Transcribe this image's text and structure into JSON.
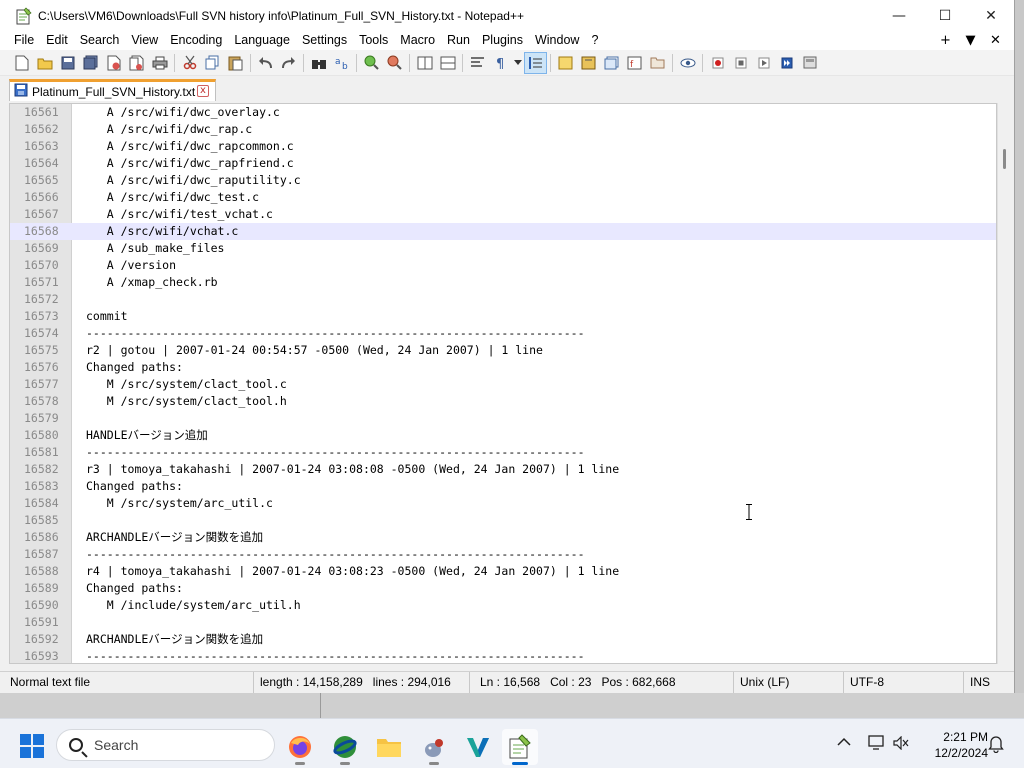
{
  "window": {
    "title": "C:\\Users\\VM6\\Downloads\\Full SVN history info\\Platinum_Full_SVN_History.txt - Notepad++",
    "minimize": "—",
    "maximize": "☐",
    "close": "✕"
  },
  "menu": {
    "items": [
      "File",
      "Edit",
      "Search",
      "View",
      "Encoding",
      "Language",
      "Settings",
      "Tools",
      "Macro",
      "Run",
      "Plugins",
      "Window",
      "?"
    ],
    "right": [
      "+",
      "▼",
      "✕"
    ]
  },
  "tab": {
    "label": "Platinum_Full_SVN_History.txt",
    "close": "x"
  },
  "editor": {
    "current_line": 16568,
    "lines": [
      {
        "n": "16561",
        "t": "   A /src/wifi/dwc_overlay.c"
      },
      {
        "n": "16562",
        "t": "   A /src/wifi/dwc_rap.c"
      },
      {
        "n": "16563",
        "t": "   A /src/wifi/dwc_rapcommon.c"
      },
      {
        "n": "16564",
        "t": "   A /src/wifi/dwc_rapfriend.c"
      },
      {
        "n": "16565",
        "t": "   A /src/wifi/dwc_raputility.c"
      },
      {
        "n": "16566",
        "t": "   A /src/wifi/dwc_test.c"
      },
      {
        "n": "16567",
        "t": "   A /src/wifi/test_vchat.c"
      },
      {
        "n": "16568",
        "t": "   A /src/wifi/vchat.c"
      },
      {
        "n": "16569",
        "t": "   A /sub_make_files"
      },
      {
        "n": "16570",
        "t": "   A /version"
      },
      {
        "n": "16571",
        "t": "   A /xmap_check.rb"
      },
      {
        "n": "16572",
        "t": ""
      },
      {
        "n": "16573",
        "t": "commit"
      },
      {
        "n": "16574",
        "t": "------------------------------------------------------------------------"
      },
      {
        "n": "16575",
        "t": "r2 | gotou | 2007-01-24 00:54:57 -0500 (Wed, 24 Jan 2007) | 1 line"
      },
      {
        "n": "16576",
        "t": "Changed paths:"
      },
      {
        "n": "16577",
        "t": "   M /src/system/clact_tool.c"
      },
      {
        "n": "16578",
        "t": "   M /src/system/clact_tool.h"
      },
      {
        "n": "16579",
        "t": ""
      },
      {
        "n": "16580",
        "t": "HANDLEバージョン追加"
      },
      {
        "n": "16581",
        "t": "------------------------------------------------------------------------"
      },
      {
        "n": "16582",
        "t": "r3 | tomoya_takahashi | 2007-01-24 03:08:08 -0500 (Wed, 24 Jan 2007) | 1 line"
      },
      {
        "n": "16583",
        "t": "Changed paths:"
      },
      {
        "n": "16584",
        "t": "   M /src/system/arc_util.c"
      },
      {
        "n": "16585",
        "t": ""
      },
      {
        "n": "16586",
        "t": "ARCHANDLEバージョン関数を追加"
      },
      {
        "n": "16587",
        "t": "------------------------------------------------------------------------"
      },
      {
        "n": "16588",
        "t": "r4 | tomoya_takahashi | 2007-01-24 03:08:23 -0500 (Wed, 24 Jan 2007) | 1 line"
      },
      {
        "n": "16589",
        "t": "Changed paths:"
      },
      {
        "n": "16590",
        "t": "   M /include/system/arc_util.h"
      },
      {
        "n": "16591",
        "t": ""
      },
      {
        "n": "16592",
        "t": "ARCHANDLEバージョン関数を追加"
      },
      {
        "n": "16593",
        "t": "------------------------------------------------------------------------"
      }
    ]
  },
  "status": {
    "file_type": "Normal text file",
    "length": "length : 14,158,289",
    "lines": "lines : 294,016",
    "ln": "Ln : 16,568",
    "col": "Col : 23",
    "pos": "Pos : 682,668",
    "eol": "Unix (LF)",
    "encoding": "UTF-8",
    "mode": "INS"
  },
  "taskbar": {
    "search_placeholder": "Search",
    "time": "2:21 PM",
    "date": "12/2/2024"
  },
  "colors": {
    "tab_accent": "#f0a030",
    "current_line_bg": "#e8e8ff",
    "gutter_bg": "#e4e4e4",
    "start_blue": "#1a73d9"
  }
}
